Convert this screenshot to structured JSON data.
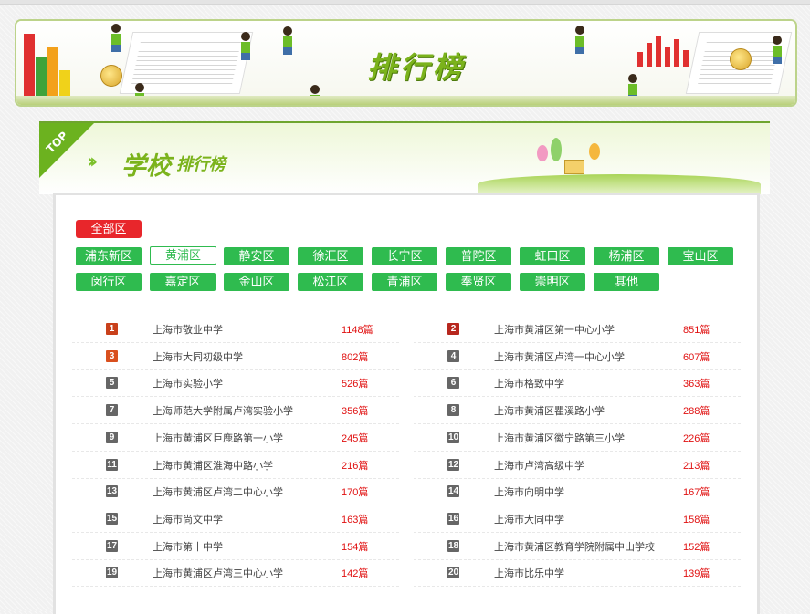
{
  "banner": {
    "title": "排行榜"
  },
  "panel": {
    "ribbon": "TOP",
    "heading_main": "学校",
    "heading_sub": "排行榜"
  },
  "districts": {
    "all": "全部区",
    "active": "黄浦区",
    "row1": [
      "浦东新区",
      "黄浦区",
      "静安区",
      "徐汇区",
      "长宁区",
      "普陀区",
      "虹口区",
      "杨浦区",
      "宝山区"
    ],
    "row2": [
      "闵行区",
      "嘉定区",
      "金山区",
      "松江区",
      "青浦区",
      "奉贤区",
      "崇明区",
      "其他"
    ]
  },
  "ranking": {
    "left": [
      {
        "rank": "1",
        "name": "上海市敬业中学",
        "count": "1148篇"
      },
      {
        "rank": "3",
        "name": "上海市大同初级中学",
        "count": "802篇"
      },
      {
        "rank": "5",
        "name": "上海市实验小学",
        "count": "526篇"
      },
      {
        "rank": "7",
        "name": "上海师范大学附属卢湾实验小学",
        "count": "356篇"
      },
      {
        "rank": "9",
        "name": "上海市黄浦区巨鹿路第一小学",
        "count": "245篇"
      },
      {
        "rank": "11",
        "name": "上海市黄浦区淮海中路小学",
        "count": "216篇"
      },
      {
        "rank": "13",
        "name": "上海市黄浦区卢湾二中心小学",
        "count": "170篇"
      },
      {
        "rank": "15",
        "name": "上海市尚文中学",
        "count": "163篇"
      },
      {
        "rank": "17",
        "name": "上海市第十中学",
        "count": "154篇"
      },
      {
        "rank": "19",
        "name": "上海市黄浦区卢湾三中心小学",
        "count": "142篇"
      }
    ],
    "right": [
      {
        "rank": "2",
        "name": "上海市黄浦区第一中心小学",
        "count": "851篇"
      },
      {
        "rank": "4",
        "name": "上海市黄浦区卢湾一中心小学",
        "count": "607篇"
      },
      {
        "rank": "6",
        "name": "上海市格致中学",
        "count": "363篇"
      },
      {
        "rank": "8",
        "name": "上海市黄浦区瞿溪路小学",
        "count": "288篇"
      },
      {
        "rank": "10",
        "name": "上海市黄浦区徽宁路第三小学",
        "count": "226篇"
      },
      {
        "rank": "12",
        "name": "上海市卢湾高级中学",
        "count": "213篇"
      },
      {
        "rank": "14",
        "name": "上海市向明中学",
        "count": "167篇"
      },
      {
        "rank": "16",
        "name": "上海市大同中学",
        "count": "158篇"
      },
      {
        "rank": "18",
        "name": "上海市黄浦区教育学院附属中山学校",
        "count": "152篇"
      },
      {
        "rank": "20",
        "name": "上海市比乐中学",
        "count": "139篇"
      }
    ]
  },
  "colors": {
    "accent_green": "#2fbb4f",
    "all_red": "#e8262b",
    "count_red": "#e01010"
  }
}
